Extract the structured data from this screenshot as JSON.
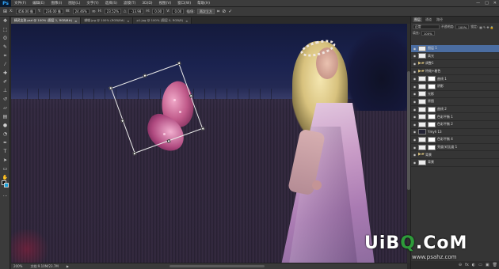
{
  "app": {
    "logo": "Ps",
    "menu": [
      "文件(F)",
      "编辑(E)",
      "图像(I)",
      "图层(L)",
      "文字(Y)",
      "选择(S)",
      "滤镜(T)",
      "3D(D)",
      "视图(V)",
      "窗口(W)",
      "帮助(H)"
    ],
    "window_controls": [
      "—",
      "□",
      "✕"
    ]
  },
  "options": {
    "x_label": "X:",
    "x_value": "456.00 像",
    "y_label": "Y:",
    "y_value": "236.00 像",
    "w_label": "W:",
    "w_value": "24.46%",
    "h_label": "H:",
    "h_value": "23.52%",
    "angle_label": "△",
    "angle_value": "-13.98",
    "h_skew_label": "H:",
    "h_skew_value": "0.00",
    "v_skew_label": "V:",
    "v_skew_value": "0.00",
    "interp_label": "插值:",
    "interp_value": "两次立方",
    "cancel_icon": "⊘",
    "commit_icon": "✓"
  },
  "tabs": [
    {
      "label": "精灵女孩.psd @ 100% (图层 1, RGB/8#)",
      "active": true
    },
    {
      "label": "蝴蝶.jpg @ 100% (RGB/8#)",
      "active": false
    },
    {
      "label": "p1.jpg @ 100% (图层 0, RGB/8)",
      "active": false
    }
  ],
  "status": {
    "zoom": "200%",
    "doc_info": "文档:9.10M/23.7M",
    "arrow": "▶"
  },
  "layers_panel": {
    "tabs": [
      "图层",
      "通道",
      "路径"
    ],
    "blend_mode": "正常",
    "opacity_label": "不透明度:",
    "opacity_value": "100%",
    "fill_label": "填充:",
    "fill_value": "100%",
    "lock_label": "锁定:",
    "layers": [
      {
        "name": "图层 1",
        "kind": "normal",
        "selected": true
      },
      {
        "name": "高光",
        "kind": "normal",
        "selected": false
      },
      {
        "name": "调整1",
        "kind": "folder",
        "selected": false
      },
      {
        "name": "特效+着色",
        "kind": "folder",
        "selected": false
      },
      {
        "name": "曲线 1",
        "kind": "adjust",
        "selected": false
      },
      {
        "name": "阴影",
        "kind": "adjust",
        "selected": false
      },
      {
        "name": "光影",
        "kind": "normal",
        "selected": false
      },
      {
        "name": "原图",
        "kind": "normal",
        "selected": false
      },
      {
        "name": "曲线 2",
        "kind": "adjust",
        "selected": false
      },
      {
        "name": "色彩平衡 1",
        "kind": "adjust",
        "selected": false
      },
      {
        "name": "色彩平衡 2",
        "kind": "adjust",
        "selected": false
      },
      {
        "name": "Ymyh 13",
        "kind": "dark",
        "selected": false
      },
      {
        "name": "色彩平衡 4",
        "kind": "adjust",
        "selected": false
      },
      {
        "name": "亮度/对比度 1",
        "kind": "adjust",
        "selected": false
      },
      {
        "name": "背景",
        "kind": "folder",
        "selected": false
      },
      {
        "name": "背景",
        "kind": "normal",
        "selected": false
      }
    ],
    "bottom_icons": [
      "⊖",
      "fx",
      "◐",
      "▭",
      "▣",
      "🗑"
    ]
  },
  "watermark": {
    "logo_part1": "UiB",
    "logo_accent": "Q",
    "logo_part2": ".CoM",
    "url": "www.psahz.com"
  }
}
